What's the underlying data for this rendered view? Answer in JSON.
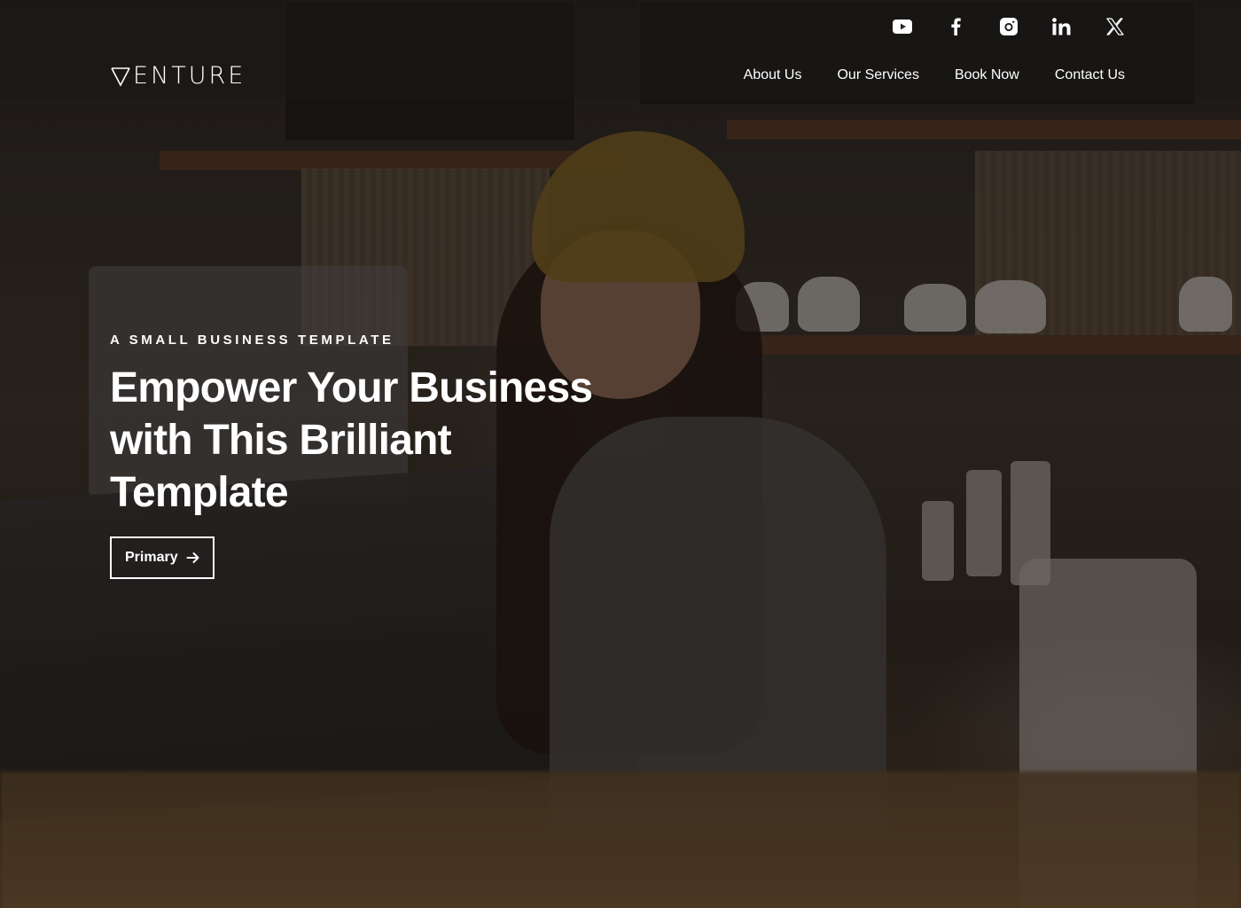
{
  "header": {
    "logo_text": "VENTURE",
    "social": [
      {
        "icon": "youtube-icon",
        "label": "YouTube"
      },
      {
        "icon": "facebook-icon",
        "label": "Facebook"
      },
      {
        "icon": "instagram-icon",
        "label": "Instagram"
      },
      {
        "icon": "linkedin-icon",
        "label": "LinkedIn"
      },
      {
        "icon": "x-twitter-icon",
        "label": "X"
      }
    ],
    "nav": [
      {
        "label": "About Us"
      },
      {
        "label": "Our Services"
      },
      {
        "label": "Book Now"
      },
      {
        "label": "Contact Us"
      }
    ]
  },
  "hero": {
    "eyebrow": "A Small Business Template",
    "title_lines": [
      "Empower Your Business",
      "with This Brilliant",
      "Template"
    ],
    "primary_button": {
      "label": "Primary",
      "icon": "arrow-right-icon"
    }
  },
  "colors": {
    "text": "#ffffff",
    "header_overlay": "#1c1816",
    "button_border": "#ffffff"
  }
}
